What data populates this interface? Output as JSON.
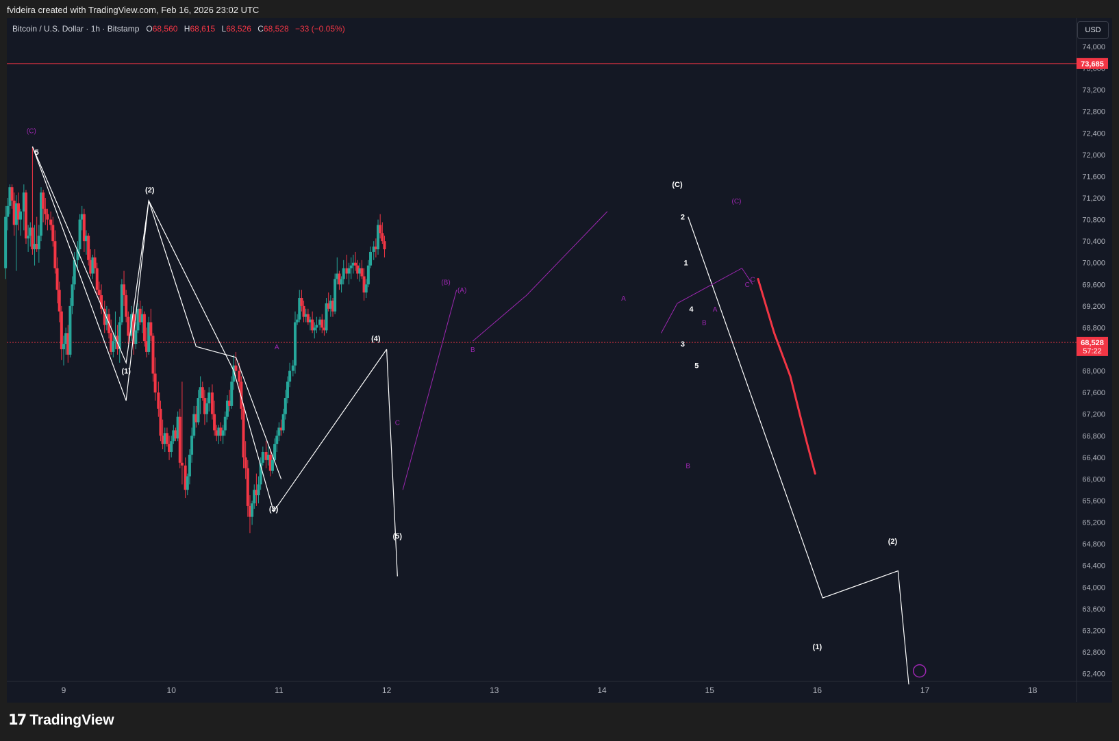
{
  "attribution": "fvideira created with TradingView.com, Feb 16, 2026 23:02 UTC",
  "symbol": {
    "name": "Bitcoin / U.S. Dollar · 1h · Bitstamp",
    "o_label": "O",
    "o": "68,560",
    "h_label": "H",
    "h": "68,615",
    "l_label": "L",
    "l": "68,526",
    "c_label": "C",
    "c": "68,528",
    "change": "−33 (−0.05%)"
  },
  "currency": "USD",
  "brand": "TradingView",
  "colors": {
    "up": "#26a69a",
    "down": "#f23645",
    "background": "#141824",
    "wave_white": "#ffffff",
    "wave_purple": "#9c27b0",
    "forecast_red": "#f23645"
  },
  "price_tags": {
    "resistance": "73,685",
    "last_price": "68,528",
    "countdown": "57:22"
  },
  "chart_data": {
    "type": "candlestick",
    "timeframe": "1h",
    "ylim": [
      62200,
      74400
    ],
    "y_ticks": [
      "74,000",
      "73,600",
      "73,200",
      "72,800",
      "72,400",
      "72,000",
      "71,600",
      "71,200",
      "70,800",
      "70,400",
      "70,000",
      "69,600",
      "69,200",
      "68,800",
      "68,400",
      "68,000",
      "67,600",
      "67,200",
      "66,800",
      "66,400",
      "66,000",
      "65,600",
      "65,200",
      "64,800",
      "64,400",
      "64,000",
      "63,600",
      "63,200",
      "62,800",
      "62,400"
    ],
    "x_ticks": [
      "9",
      "10",
      "11",
      "12",
      "13",
      "14",
      "15",
      "16",
      "17",
      "18"
    ],
    "x_range_days": [
      8.45,
      18.4
    ],
    "horizontal_line": 73685,
    "last_price": 68528,
    "candles": [
      [
        8.46,
        69900,
        71050,
        69700,
        70850
      ],
      [
        8.48,
        70850,
        71200,
        70600,
        71050
      ],
      [
        8.5,
        71050,
        71450,
        70900,
        71400
      ],
      [
        8.52,
        71400,
        71450,
        71000,
        71150
      ],
      [
        8.54,
        71150,
        71300,
        70500,
        70700
      ],
      [
        8.56,
        70700,
        71250,
        69850,
        71100
      ],
      [
        8.58,
        71100,
        71300,
        70600,
        70800
      ],
      [
        8.6,
        70800,
        71000,
        70500,
        70950
      ],
      [
        8.63,
        70950,
        71450,
        70600,
        71300
      ],
      [
        8.65,
        71300,
        71350,
        70350,
        70450
      ],
      [
        8.67,
        70450,
        70700,
        70200,
        70500
      ],
      [
        8.69,
        70500,
        70750,
        70300,
        70650
      ],
      [
        8.71,
        70650,
        72150,
        70150,
        70250
      ],
      [
        8.73,
        70250,
        70700,
        69950,
        70350
      ],
      [
        8.75,
        70350,
        70850,
        70200,
        70250
      ],
      [
        8.77,
        70250,
        70700,
        70000,
        70500
      ],
      [
        8.79,
        70500,
        71400,
        70400,
        71300
      ],
      [
        8.81,
        71300,
        71350,
        70750,
        71000
      ],
      [
        8.83,
        71000,
        71200,
        70700,
        70900
      ],
      [
        8.85,
        70900,
        71000,
        70600,
        70800
      ],
      [
        8.88,
        70800,
        70950,
        70600,
        70700
      ],
      [
        8.9,
        70700,
        70850,
        70300,
        70400
      ],
      [
        8.92,
        70400,
        70600,
        69800,
        69900
      ],
      [
        8.94,
        69900,
        70100,
        69250,
        69500
      ],
      [
        8.96,
        69500,
        69650,
        68900,
        69100
      ],
      [
        8.98,
        69100,
        69200,
        68200,
        68400
      ],
      [
        9.0,
        68400,
        68650,
        68100,
        68500
      ],
      [
        9.02,
        68500,
        68800,
        68300,
        68700
      ],
      [
        9.04,
        68700,
        68850,
        68150,
        68300
      ],
      [
        9.06,
        68300,
        69350,
        68250,
        69200
      ],
      [
        9.08,
        69200,
        69750,
        69050,
        69600
      ],
      [
        9.1,
        69600,
        70200,
        69500,
        70050
      ],
      [
        9.13,
        70050,
        70400,
        69850,
        70250
      ],
      [
        9.15,
        70250,
        70900,
        70100,
        70800
      ],
      [
        9.17,
        70800,
        71050,
        70600,
        70900
      ],
      [
        9.19,
        70900,
        71000,
        70200,
        70400
      ],
      [
        9.21,
        70400,
        70600,
        70150,
        70500
      ],
      [
        9.23,
        70500,
        70550,
        69950,
        70050
      ],
      [
        9.25,
        70050,
        70250,
        69750,
        69800
      ],
      [
        9.27,
        69800,
        70150,
        69700,
        70100
      ],
      [
        9.29,
        70100,
        70250,
        69800,
        69900
      ],
      [
        9.31,
        69900,
        70000,
        69400,
        69500
      ],
      [
        9.33,
        69500,
        69650,
        69300,
        69400
      ],
      [
        9.35,
        69400,
        69600,
        69050,
        69150
      ],
      [
        9.38,
        69150,
        69300,
        68700,
        68850
      ],
      [
        9.4,
        68850,
        69200,
        68750,
        69050
      ],
      [
        9.42,
        69050,
        69150,
        68600,
        68700
      ],
      [
        9.44,
        68700,
        68950,
        68300,
        68350
      ],
      [
        9.46,
        68350,
        68700,
        68250,
        68550
      ],
      [
        9.48,
        68550,
        69100,
        68400,
        68650
      ],
      [
        9.5,
        68650,
        68850,
        68300,
        68400
      ],
      [
        9.52,
        68400,
        69000,
        68150,
        68900
      ],
      [
        9.54,
        68900,
        69700,
        68850,
        69600
      ],
      [
        9.56,
        69600,
        69850,
        69200,
        69400
      ],
      [
        9.58,
        69400,
        69500,
        68900,
        69000
      ],
      [
        9.6,
        69000,
        69100,
        68500,
        68650
      ],
      [
        9.63,
        68650,
        69200,
        68550,
        69050
      ],
      [
        9.65,
        69050,
        69100,
        68300,
        68500
      ],
      [
        9.67,
        68500,
        68900,
        68400,
        68750
      ],
      [
        9.69,
        68750,
        69250,
        68700,
        69150
      ],
      [
        9.71,
        69150,
        69300,
        68850,
        68900
      ],
      [
        9.73,
        68900,
        69200,
        68700,
        69050
      ],
      [
        9.75,
        69050,
        69100,
        68450,
        68550
      ],
      [
        9.77,
        68550,
        68800,
        68250,
        68350
      ],
      [
        9.79,
        68350,
        69000,
        68300,
        68900
      ],
      [
        9.81,
        68900,
        69150,
        68550,
        68650
      ],
      [
        9.83,
        68650,
        68700,
        67800,
        67950
      ],
      [
        9.85,
        67950,
        68250,
        67450,
        67600
      ],
      [
        9.88,
        67600,
        67800,
        67150,
        67300
      ],
      [
        9.9,
        67300,
        67450,
        66700,
        66800
      ],
      [
        9.92,
        66800,
        67100,
        66550,
        66650
      ],
      [
        9.94,
        66650,
        66950,
        66500,
        66850
      ],
      [
        9.96,
        66850,
        66950,
        66600,
        66650
      ],
      [
        9.98,
        66650,
        66800,
        66350,
        66500
      ],
      [
        10.0,
        66500,
        66800,
        66400,
        66700
      ],
      [
        10.02,
        66700,
        67000,
        66650,
        66900
      ],
      [
        10.04,
        66900,
        66950,
        66700,
        66750
      ],
      [
        10.06,
        66750,
        67250,
        66700,
        67150
      ],
      [
        10.08,
        67150,
        67300,
        66200,
        66300
      ],
      [
        10.1,
        66300,
        67800,
        65900,
        66250
      ],
      [
        10.13,
        66250,
        66400,
        65650,
        65800
      ],
      [
        10.15,
        65800,
        66100,
        65700,
        66050
      ],
      [
        10.17,
        66050,
        66550,
        65900,
        66450
      ],
      [
        10.19,
        66450,
        66950,
        66300,
        66800
      ],
      [
        10.21,
        66800,
        67350,
        66750,
        67200
      ],
      [
        10.23,
        67200,
        67350,
        66950,
        67050
      ],
      [
        10.25,
        67050,
        67650,
        67000,
        67500
      ],
      [
        10.27,
        67500,
        67900,
        67200,
        67700
      ],
      [
        10.29,
        67700,
        67800,
        67450,
        67500
      ],
      [
        10.31,
        67500,
        67650,
        67000,
        67200
      ],
      [
        10.33,
        67200,
        67500,
        67050,
        67400
      ],
      [
        10.35,
        67400,
        67700,
        67250,
        67600
      ],
      [
        10.38,
        67600,
        67750,
        67100,
        67200
      ],
      [
        10.4,
        67200,
        67450,
        66800,
        66900
      ],
      [
        10.42,
        66900,
        67000,
        66700,
        66800
      ],
      [
        10.44,
        66800,
        67000,
        66650,
        66950
      ],
      [
        10.46,
        66950,
        67050,
        66700,
        66800
      ],
      [
        10.48,
        66800,
        67000,
        66650,
        66900
      ],
      [
        10.5,
        66900,
        67250,
        66800,
        67150
      ],
      [
        10.52,
        67150,
        67550,
        67100,
        67450
      ],
      [
        10.54,
        67450,
        67650,
        67250,
        67350
      ],
      [
        10.56,
        67350,
        67900,
        67300,
        67800
      ],
      [
        10.58,
        67800,
        68300,
        67650,
        68100
      ],
      [
        10.6,
        68100,
        68350,
        67900,
        68000
      ],
      [
        10.63,
        68000,
        68150,
        67600,
        67800
      ],
      [
        10.65,
        67800,
        67900,
        67100,
        67300
      ],
      [
        10.67,
        67300,
        67400,
        66200,
        66400
      ],
      [
        10.69,
        66400,
        66700,
        66000,
        66200
      ],
      [
        10.71,
        66200,
        66350,
        65300,
        65500
      ],
      [
        10.73,
        65500,
        65700,
        65000,
        65300
      ],
      [
        10.75,
        65300,
        65600,
        65150,
        65550
      ],
      [
        10.77,
        65550,
        65900,
        65450,
        65800
      ],
      [
        10.79,
        65800,
        66100,
        65500,
        65700
      ],
      [
        10.81,
        65700,
        66050,
        65550,
        65900
      ],
      [
        10.83,
        65900,
        66400,
        65800,
        66300
      ],
      [
        10.85,
        66300,
        66600,
        66250,
        66500
      ],
      [
        10.88,
        66500,
        66700,
        66200,
        66350
      ],
      [
        10.9,
        66350,
        66600,
        66250,
        66450
      ],
      [
        10.92,
        66450,
        66550,
        66050,
        66150
      ],
      [
        10.94,
        66150,
        66450,
        66100,
        66350
      ],
      [
        10.96,
        66350,
        66750,
        66300,
        66650
      ],
      [
        10.98,
        66650,
        66900,
        66500,
        66800
      ],
      [
        11.0,
        66800,
        67050,
        66700,
        66950
      ],
      [
        11.02,
        66950,
        67100,
        66800,
        66900
      ],
      [
        11.04,
        66900,
        67300,
        66850,
        67200
      ],
      [
        11.06,
        67200,
        67650,
        67100,
        67500
      ],
      [
        11.08,
        67500,
        67900,
        67400,
        67800
      ],
      [
        11.1,
        67800,
        68150,
        67700,
        68000
      ],
      [
        11.13,
        68000,
        68200,
        67900,
        68100
      ],
      [
        11.15,
        68100,
        69100,
        67950,
        68900
      ],
      [
        11.17,
        68900,
        69050,
        68850,
        68950
      ],
      [
        11.19,
        68950,
        69500,
        68900,
        69350
      ],
      [
        11.21,
        69350,
        69500,
        69100,
        69200
      ],
      [
        11.23,
        69200,
        69300,
        68900,
        69000
      ],
      [
        11.25,
        69000,
        69150,
        68900,
        69050
      ],
      [
        11.27,
        69050,
        69150,
        68850,
        68900
      ],
      [
        11.29,
        68900,
        69000,
        68750,
        68950
      ],
      [
        11.31,
        68950,
        69100,
        68700,
        68750
      ],
      [
        11.33,
        68750,
        68900,
        68600,
        68800
      ],
      [
        11.35,
        68800,
        69000,
        68700,
        68850
      ],
      [
        11.38,
        68850,
        69000,
        68750,
        68950
      ],
      [
        11.4,
        68950,
        69050,
        68700,
        68800
      ],
      [
        11.42,
        68800,
        68950,
        68650,
        68750
      ],
      [
        11.44,
        68750,
        69350,
        68700,
        69250
      ],
      [
        11.46,
        69250,
        69450,
        69100,
        69150
      ],
      [
        11.48,
        69150,
        69400,
        69000,
        69300
      ],
      [
        11.5,
        69300,
        69350,
        69000,
        69100
      ],
      [
        11.52,
        69100,
        69800,
        69050,
        69700
      ],
      [
        11.54,
        69700,
        70100,
        69600,
        69800
      ],
      [
        11.56,
        69800,
        69850,
        69500,
        69600
      ],
      [
        11.58,
        69600,
        69750,
        69450,
        69700
      ],
      [
        11.6,
        69700,
        70050,
        69600,
        69900
      ],
      [
        11.63,
        69900,
        70150,
        69700,
        69800
      ],
      [
        11.65,
        69800,
        70000,
        69600,
        69900
      ],
      [
        11.67,
        69900,
        70100,
        69700,
        69950
      ],
      [
        11.69,
        69950,
        70150,
        69800,
        70000
      ],
      [
        11.71,
        70000,
        70200,
        69850,
        69950
      ],
      [
        11.73,
        69950,
        70050,
        69700,
        69800
      ],
      [
        11.75,
        69800,
        70000,
        69650,
        69900
      ],
      [
        11.77,
        69900,
        70050,
        69700,
        69750
      ],
      [
        11.79,
        69750,
        69900,
        69300,
        69450
      ],
      [
        11.81,
        69450,
        69700,
        69350,
        69600
      ],
      [
        11.83,
        69600,
        70050,
        69550,
        69950
      ],
      [
        11.85,
        69950,
        70300,
        69900,
        70200
      ],
      [
        11.88,
        70200,
        70400,
        70050,
        70300
      ],
      [
        11.9,
        70300,
        70450,
        70100,
        70250
      ],
      [
        11.92,
        70250,
        70800,
        70150,
        70700
      ],
      [
        11.94,
        70700,
        70900,
        70450,
        70550
      ],
      [
        11.96,
        70550,
        70750,
        70350,
        70400
      ],
      [
        11.98,
        70400,
        70500,
        70100,
        70250
      ]
    ],
    "wave_labels": {
      "white": [
        "3",
        "4",
        "(C)",
        "5",
        "(1)",
        "(2)",
        "(3)",
        "(4)",
        "(5)",
        "(C)",
        "2",
        "1",
        "4",
        "3",
        "5",
        "(1)",
        "(2)"
      ],
      "purple": [
        "(C)",
        "A",
        "C",
        "(A)",
        "(B)",
        "B",
        "A",
        "C",
        "B",
        "A",
        "C",
        "B",
        "(C)"
      ]
    }
  }
}
